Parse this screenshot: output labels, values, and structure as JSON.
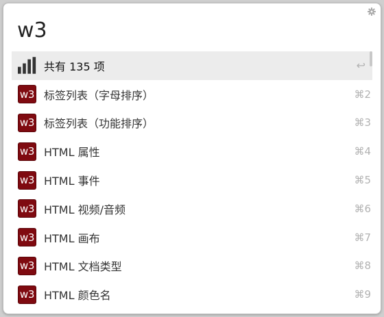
{
  "query": {
    "value": "w3"
  },
  "settings_icon": "gear-icon",
  "results": [
    {
      "icon": "bar-chart-icon",
      "label": "共有 135 项",
      "shortcut": "↩",
      "selected": true
    },
    {
      "icon": "w3-icon",
      "icon_text": "w3",
      "label": "标签列表（字母排序）",
      "shortcut": "⌘2"
    },
    {
      "icon": "w3-icon",
      "icon_text": "w3",
      "label": "标签列表（功能排序）",
      "shortcut": "⌘3"
    },
    {
      "icon": "w3-icon",
      "icon_text": "w3",
      "label": "HTML 属性",
      "shortcut": "⌘4"
    },
    {
      "icon": "w3-icon",
      "icon_text": "w3",
      "label": "HTML 事件",
      "shortcut": "⌘5"
    },
    {
      "icon": "w3-icon",
      "icon_text": "w3",
      "label": "HTML 视频/音频",
      "shortcut": "⌘6"
    },
    {
      "icon": "w3-icon",
      "icon_text": "w3",
      "label": "HTML 画布",
      "shortcut": "⌘7"
    },
    {
      "icon": "w3-icon",
      "icon_text": "w3",
      "label": "HTML 文档类型",
      "shortcut": "⌘8"
    },
    {
      "icon": "w3-icon",
      "icon_text": "w3",
      "label": "HTML 颜色名",
      "shortcut": "⌘9"
    }
  ],
  "colors": {
    "w3_icon_bg": "#7f0a10",
    "selected_row_bg": "#ececec",
    "shortcut_text": "#b2b2b2"
  }
}
